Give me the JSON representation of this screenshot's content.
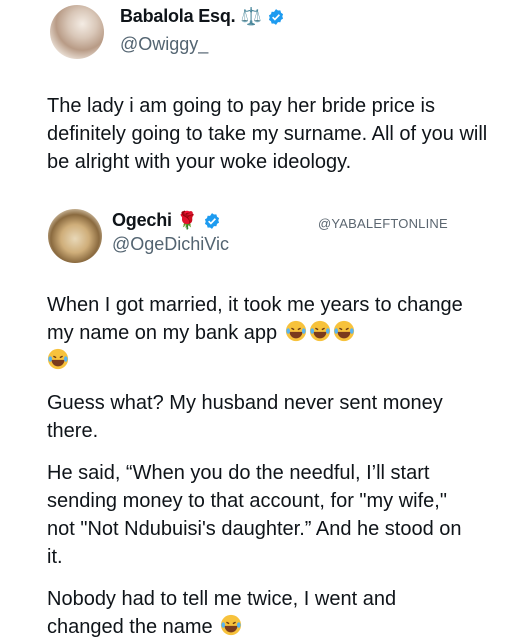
{
  "tweet1": {
    "display_name": "Babalola Esq.",
    "name_emoji": "⚖️",
    "handle": "@Owiggy_",
    "text": "The lady i am going to pay her bride price is definitely going to take my surname. All of you will be alright with your woke ideology."
  },
  "tweet2": {
    "display_name": "Ogechi",
    "name_emoji": "🌹",
    "handle": "@OgeDichiVic",
    "watermark": "@YABALEFTONLINE",
    "paragraphs": [
      "When I got married, it took me years to change my name on my bank app",
      "Guess what? My husband never sent money there.",
      "He said, “When you do the needful, I’ll start sending money to that account, for \"my wife,\" not \"Not Ndubuisi's daughter.” And he stood on it.",
      "Nobody had to tell me twice, I went and changed the name"
    ]
  },
  "colors": {
    "verified": "#1d9bf0",
    "text": "#0f1419",
    "muted": "#536471"
  },
  "icons": [
    "verified-badge-icon",
    "laughing-emoji-icon"
  ]
}
